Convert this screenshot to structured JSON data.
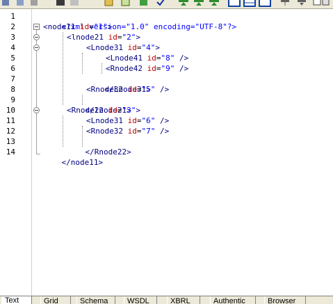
{
  "toolbar": {
    "icons": [
      "cut-icon",
      "copy-icon",
      "paste-icon",
      "open-icon",
      "save-icon",
      "validate-icon",
      "check-icon",
      "insert-before-icon",
      "insert-after-icon",
      "append-child-icon",
      "view-text-icon",
      "view-grid-icon",
      "view-schema-icon",
      "tree-icon",
      "tree-down-icon",
      "more-icon"
    ]
  },
  "editor": {
    "line_numbers": [
      "1",
      "2",
      "3",
      "4",
      "5",
      "6",
      "7",
      "8",
      "9",
      "10",
      "11",
      "12",
      "13",
      "14"
    ],
    "lines": [
      {
        "text": "<?xml version=\"1.0\" encoding=\"UTF-8\"?>"
      },
      {
        "tag_open": "<node11 ",
        "attr": "id",
        "eq": "=",
        "val": "\"1\"",
        "close": ">"
      },
      {
        "tag_open": "<lnode21 ",
        "attr": "id",
        "eq": "=",
        "val": "\"2\"",
        "close": ">"
      },
      {
        "tag_open": "<Lnode31 ",
        "attr": "id",
        "eq": "=",
        "val": "\"4\"",
        "close": ">"
      },
      {
        "tag_open": "<Lnode41 ",
        "attr": "id",
        "eq": "=",
        "val": "\"8\"",
        "close": " />"
      },
      {
        "tag_open": "<Rnode42 ",
        "attr": "id",
        "eq": "=",
        "val": "\"9\"",
        "close": " />"
      },
      {
        "text": "</Lnode31>"
      },
      {
        "tag_open": "<Rnode32 ",
        "attr": "id",
        "eq": "=",
        "val": "\"5\"",
        "close": " />"
      },
      {
        "text": "</lnode21>"
      },
      {
        "tag_open": "<Rnode22 ",
        "attr": "id",
        "eq": "=",
        "val": "\"3\"",
        "close": ">"
      },
      {
        "tag_open": "<Lnode31 ",
        "attr": "id",
        "eq": "=",
        "val": "\"6\"",
        "close": " />"
      },
      {
        "tag_open": "<Rnode32 ",
        "attr": "id",
        "eq": "=",
        "val": "\"7\"",
        "close": " />"
      },
      {
        "text": "</Rnode22>"
      },
      {
        "text": "</node11>"
      }
    ],
    "colors": {
      "pi": "#0000ff",
      "tag": "#000080",
      "attr": "#c00000",
      "value": "#0000ff"
    }
  },
  "tabs": [
    {
      "label": "Text",
      "active": true
    },
    {
      "label": "Grid"
    },
    {
      "label": "Schema"
    },
    {
      "label": "WSDL"
    },
    {
      "label": "XBRL"
    },
    {
      "label": "Authentic"
    },
    {
      "label": "Browser"
    }
  ]
}
